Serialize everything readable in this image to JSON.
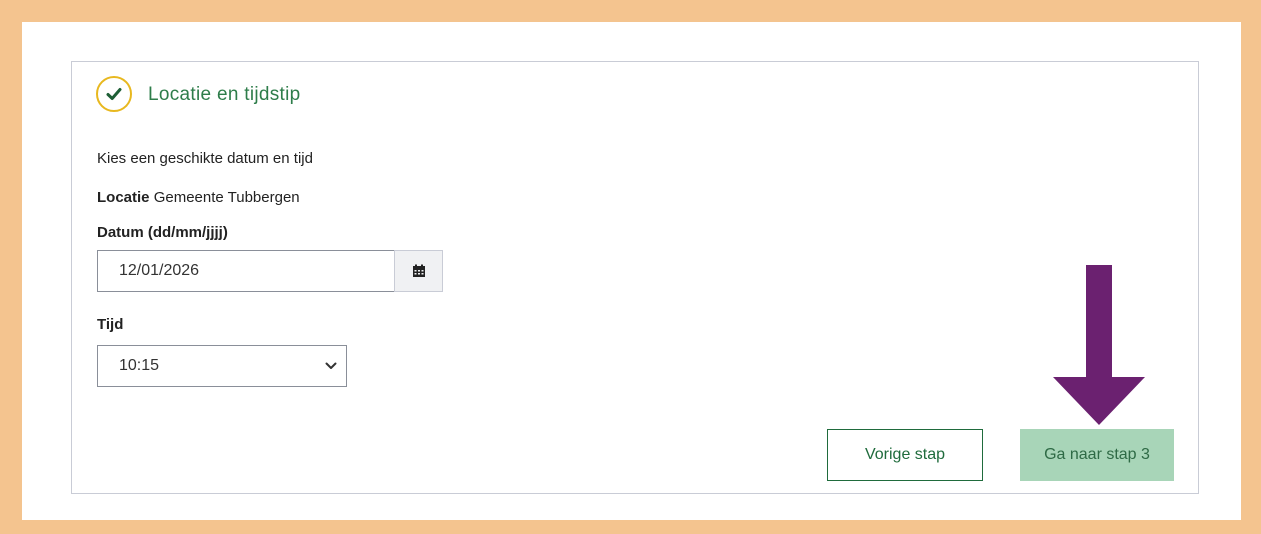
{
  "section": {
    "title": "Locatie en tijdstip",
    "intro": "Kies een geschikte datum en tijd"
  },
  "location": {
    "label": "Locatie",
    "value": "Gemeente Tubbergen"
  },
  "date": {
    "label": "Datum (dd/mm/jjjj)",
    "value": "12/01/2026"
  },
  "time": {
    "label": "Tijd",
    "value": "10:15"
  },
  "buttons": {
    "previous": "Vorige stap",
    "next": "Ga naar stap 3"
  },
  "colors": {
    "frame": "#f4c48f",
    "accent_green": "#2e7d4a",
    "check_ring": "#e8b81f",
    "next_button_bg": "#a8d5b8",
    "annotation_arrow": "#6b2170"
  },
  "icons": {
    "status": "check-circle-icon",
    "calendar": "calendar-icon",
    "select": "chevron-down-icon",
    "annotation": "arrow-down-icon"
  }
}
